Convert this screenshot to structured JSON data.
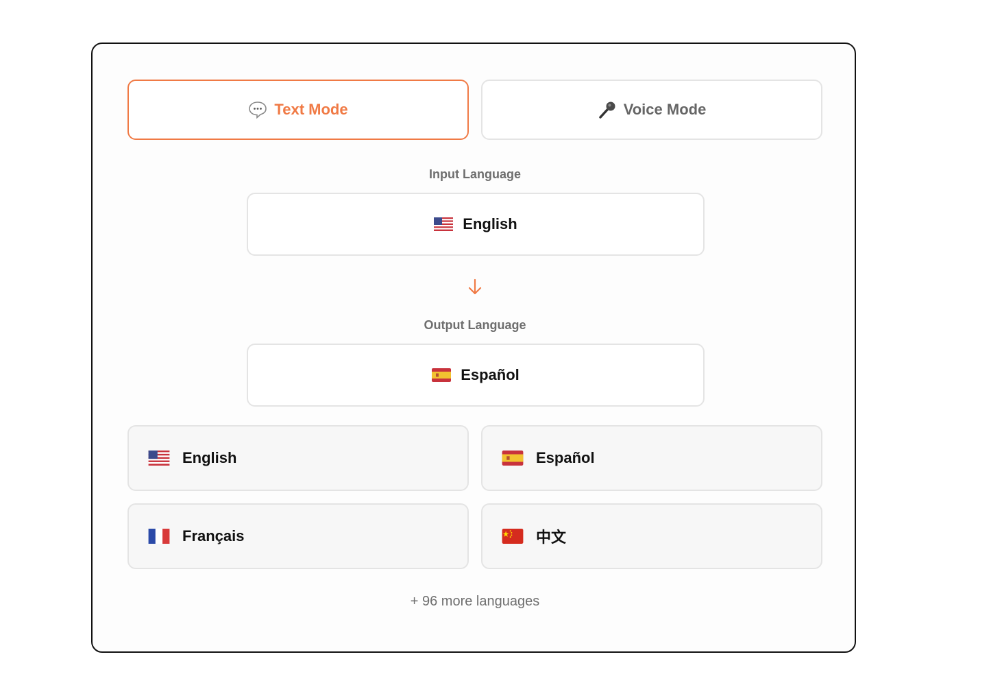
{
  "modes": {
    "text": {
      "label": "Text Mode",
      "icon": "speech-bubble-icon",
      "active": true
    },
    "voice": {
      "label": "Voice Mode",
      "icon": "microphone-icon",
      "active": false
    }
  },
  "input": {
    "label": "Input Language",
    "value": "English",
    "flag": "us-flag-icon"
  },
  "output": {
    "label": "Output Language",
    "value": "Español",
    "flag": "spain-flag-icon"
  },
  "quick_languages": [
    {
      "label": "English",
      "flag": "us-flag-icon"
    },
    {
      "label": "Español",
      "flag": "spain-flag-icon"
    },
    {
      "label": "Français",
      "flag": "france-flag-icon"
    },
    {
      "label": "中文",
      "flag": "china-flag-icon"
    }
  ],
  "more_languages": "+ 96 more languages",
  "colors": {
    "accent": "#f07a45",
    "border": "#e4e4e4",
    "muted_text": "#6e6e6e"
  }
}
